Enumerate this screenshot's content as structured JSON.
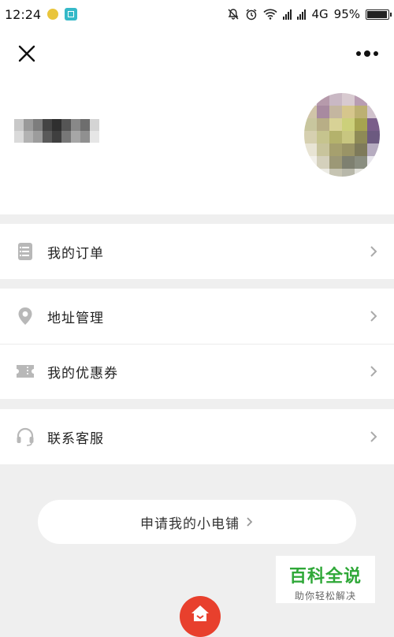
{
  "status_bar": {
    "time": "12:24",
    "network": "4G",
    "battery": "95%",
    "battery_level": 0.95
  },
  "header": {
    "close_icon": "close-icon",
    "more_icon": "more-dots-icon"
  },
  "menu": {
    "orders": {
      "label": "我的订单",
      "icon": "order-list-icon"
    },
    "address": {
      "label": "地址管理",
      "icon": "location-pin-icon"
    },
    "coupons": {
      "label": "我的优惠券",
      "icon": "ticket-icon"
    },
    "service": {
      "label": "联系客服",
      "icon": "headset-icon"
    }
  },
  "apply_shop": {
    "label": "申请我的小电铺"
  },
  "watermark": {
    "title": "百科全说",
    "subtitle": "助你轻松解决"
  },
  "colors": {
    "background": "#efefef",
    "card": "#ffffff",
    "accent_red": "#e8402d",
    "watermark_green": "#2fa838",
    "icon_gray": "#b8b8b8"
  }
}
